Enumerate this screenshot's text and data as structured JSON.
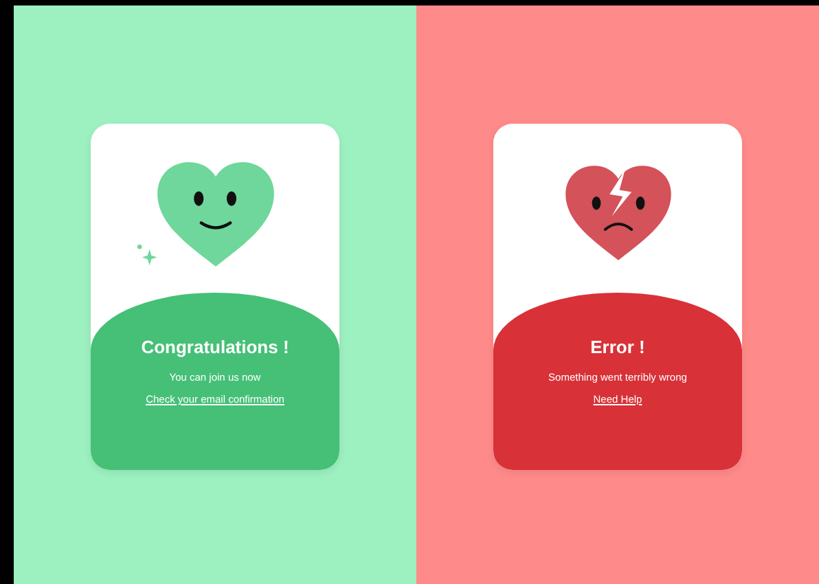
{
  "panels": [
    {
      "kind": "success",
      "title": "Congratulations !",
      "message": "You can join us now",
      "link": "Check your email confirmation"
    },
    {
      "kind": "error",
      "title": "Error !",
      "message": "Something went terribly wrong",
      "link": "Need Help"
    }
  ]
}
